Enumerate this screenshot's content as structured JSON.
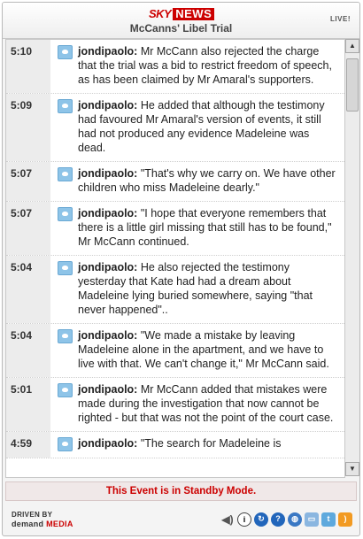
{
  "header": {
    "logo_sky": "SKY",
    "logo_news": "NEWS",
    "title": "McCanns' Libel Trial",
    "live": "LIVE!"
  },
  "entries": [
    {
      "time": "5:10",
      "author": "jondipaolo:",
      "text": " Mr McCann also rejected the charge that the trial was a bid to restrict freedom of speech, as has been claimed by Mr Amaral's supporters."
    },
    {
      "time": "5:09",
      "author": "jondipaolo:",
      "text": " He added that although the testimony had favoured Mr Amaral's version of events, it still had not produced any evidence Madeleine was dead."
    },
    {
      "time": "5:07",
      "author": "jondipaolo:",
      "text": " \"That's why we carry on. We have other children who miss Madeleine dearly.\""
    },
    {
      "time": "5:07",
      "author": "jondipaolo:",
      "text": " \"I hope that everyone remembers that there is a little girl missing that still has to be found,\" Mr McCann continued."
    },
    {
      "time": "5:04",
      "author": "jondipaolo:",
      "text": " He also rejected the testimony yesterday that Kate had had a dream about Madeleine lying buried somewhere, saying \"that never happened\".."
    },
    {
      "time": "5:04",
      "author": "jondipaolo:",
      "text": " \"We made a mistake by leaving Madeleine alone in the apartment, and we have to live with that. We can't change it,\" Mr McCann said."
    },
    {
      "time": "5:01",
      "author": "jondipaolo:",
      "text": " Mr McCann added that mistakes were made during the investigation that now cannot be righted - but that was not the point of the court case."
    },
    {
      "time": "4:59",
      "author": "jondipaolo:",
      "text": " \"The search for Madeleine is"
    }
  ],
  "status": "This Event is in Standby Mode.",
  "footer": {
    "driven_by": "DRIVEN BY",
    "brand_demand": "demand",
    "brand_media": "MEDIA",
    "icons": [
      "sound-icon",
      "info-icon",
      "refresh-icon",
      "help-icon",
      "globe-icon",
      "chat-icon",
      "twitter-icon",
      "rss-icon"
    ]
  }
}
